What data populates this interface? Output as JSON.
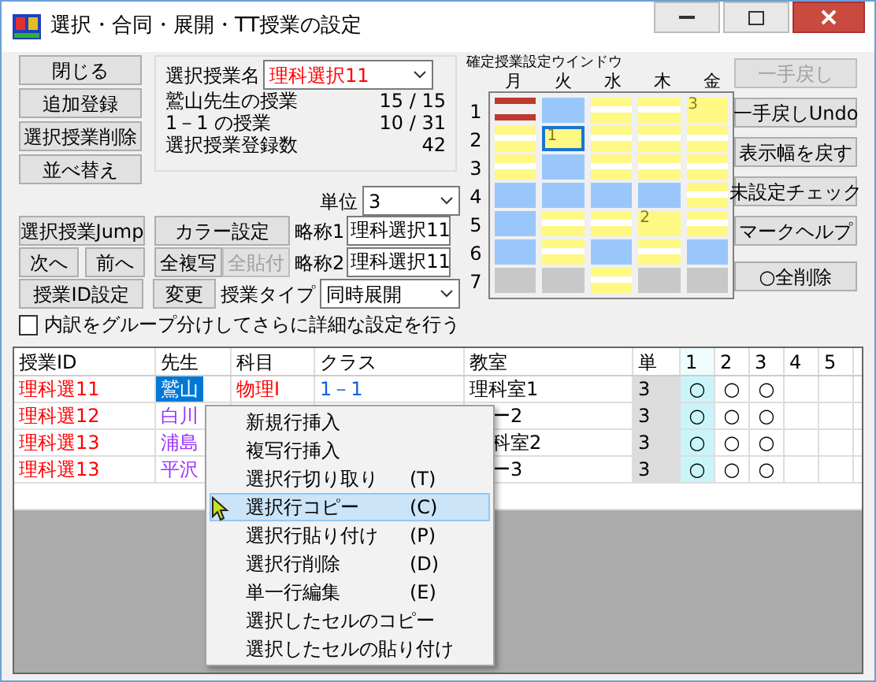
{
  "window": {
    "title": "選択・合同・展開・TT授業の設定"
  },
  "left_buttons": [
    {
      "label": "閉じる"
    },
    {
      "label": "追加登録"
    },
    {
      "label": "選択授業削除"
    },
    {
      "label": "並べ替え"
    }
  ],
  "info": {
    "name_label": "選択授業名",
    "name_value": "理科選択11",
    "lines": [
      {
        "label": "鷲山先生の授業",
        "value": "15 / 15"
      },
      {
        "label": "1－1 の授業",
        "value": "10 / 31"
      },
      {
        "label": "選択授業登録数",
        "value": "42"
      }
    ]
  },
  "unit": {
    "label": "単位",
    "value": "3"
  },
  "buttons": {
    "jump": "選択授業Jump",
    "next": "次へ",
    "prev": "前へ",
    "id_setting": "授業ID設定",
    "color_setting": "カラー設定",
    "copy_all": {
      "label": "全複写",
      "disabled": false
    },
    "paste_all": {
      "label": "全貼付",
      "disabled": true
    },
    "change": "変更"
  },
  "abbr": [
    {
      "label": "略称1",
      "value": "理科選択11"
    },
    {
      "label": "略称2",
      "value": "理科選択11"
    }
  ],
  "lesson_type": {
    "label": "授業タイプ",
    "value": "同時展開"
  },
  "detail_checkbox": {
    "label": "内訳をグループ分けしてさらに詳細な設定を行う",
    "checked": false
  },
  "grid": {
    "title": "確定授業設定ウインドウ",
    "days": [
      "月",
      "火",
      "水",
      "木",
      "金"
    ],
    "periods": [
      "1",
      "2",
      "3",
      "4",
      "5",
      "6",
      "7"
    ],
    "rows": [
      [
        {
          "kind": "red",
          "selected": false
        },
        {
          "kind": "blue",
          "selected": false
        },
        {
          "kind": "stripe",
          "selected": false
        },
        {
          "kind": "stripe",
          "selected": false
        },
        {
          "kind": "solid",
          "mark": "3",
          "selected": false
        }
      ],
      [
        {
          "kind": "stripe",
          "selected": false
        },
        {
          "kind": "solid",
          "mark": "1",
          "selected": true
        },
        {
          "kind": "stripe",
          "selected": false
        },
        {
          "kind": "stripe",
          "selected": false
        },
        {
          "kind": "stripe",
          "selected": false
        }
      ],
      [
        {
          "kind": "stripe",
          "selected": false
        },
        {
          "kind": "blue",
          "selected": false
        },
        {
          "kind": "stripe",
          "selected": false
        },
        {
          "kind": "stripe",
          "selected": false
        },
        {
          "kind": "stripe",
          "selected": false
        }
      ],
      [
        {
          "kind": "blue",
          "selected": false
        },
        {
          "kind": "blue",
          "selected": false
        },
        {
          "kind": "blue",
          "selected": false
        },
        {
          "kind": "blue",
          "selected": false
        },
        {
          "kind": "stripe",
          "selected": false
        }
      ],
      [
        {
          "kind": "blue",
          "selected": false
        },
        {
          "kind": "stripe",
          "selected": false
        },
        {
          "kind": "stripe",
          "selected": false
        },
        {
          "kind": "solid",
          "mark": "2",
          "selected": false
        },
        {
          "kind": "stripe",
          "selected": false
        }
      ],
      [
        {
          "kind": "blue",
          "selected": false
        },
        {
          "kind": "stripe",
          "selected": false
        },
        {
          "kind": "blue",
          "selected": false
        },
        {
          "kind": "stripe",
          "selected": false
        },
        {
          "kind": "blue",
          "selected": false
        }
      ],
      [
        {
          "kind": "grey",
          "selected": false
        },
        {
          "kind": "grey",
          "selected": false
        },
        {
          "kind": "stripe",
          "selected": false
        },
        {
          "kind": "grey",
          "selected": false
        },
        {
          "kind": "grey",
          "selected": false
        }
      ]
    ]
  },
  "right_buttons": [
    {
      "label": "一手戻し",
      "disabled": true
    },
    {
      "label": "一手戻しUndo",
      "disabled": false
    },
    {
      "label": "表示幅を戻す",
      "disabled": false
    },
    {
      "label": "未設定チェック",
      "disabled": false
    },
    {
      "label": "マークヘルプ",
      "disabled": false
    },
    {
      "label": "○全削除",
      "disabled": false
    }
  ],
  "table": {
    "columns": [
      {
        "label": "授業ID",
        "selected": false
      },
      {
        "label": "先生",
        "selected": false
      },
      {
        "label": "科目",
        "selected": false
      },
      {
        "label": "クラス",
        "selected": false
      },
      {
        "label": "教室",
        "selected": false
      },
      {
        "label": "単",
        "selected": false
      },
      {
        "label": "1",
        "selected": true
      },
      {
        "label": "2",
        "selected": false
      },
      {
        "label": "3",
        "selected": false
      },
      {
        "label": "4",
        "selected": false
      },
      {
        "label": "5",
        "selected": false
      }
    ],
    "rows": [
      {
        "id": "理科選11",
        "teacher": "鷲山",
        "teacher_selected": true,
        "subject": "物理Ⅰ",
        "class": "1－1",
        "room": "理科室1",
        "unit": "3",
        "marks": [
          "○",
          "○",
          "○"
        ]
      },
      {
        "id": "理科選12",
        "teacher": "白川",
        "teacher_selected": false,
        "room": "ー2",
        "unit": "3",
        "marks": [
          "○",
          "○",
          "○"
        ]
      },
      {
        "id": "理科選13",
        "teacher": "浦島",
        "teacher_selected": false,
        "room": "科室2",
        "unit": "3",
        "marks": [
          "○",
          "○",
          "○"
        ]
      },
      {
        "id": "理科選13",
        "teacher": "平沢",
        "teacher_selected": false,
        "room": "ー3",
        "unit": "3",
        "marks": [
          "○",
          "○",
          "○"
        ]
      }
    ]
  },
  "context_menu": {
    "items": [
      {
        "label": "新規行挿入",
        "selected": false
      },
      {
        "label": "複写行挿入",
        "selected": false
      },
      {
        "label": "選択行切り取り",
        "shortcut": "(T)",
        "selected": false
      },
      {
        "label": "選択行コピー",
        "shortcut": "(C)",
        "selected": true
      },
      {
        "label": "選択行貼り付け",
        "shortcut": "(P)",
        "selected": false
      },
      {
        "label": "選択行削除",
        "shortcut": "(D)",
        "selected": false
      },
      {
        "label": "単一行編集",
        "shortcut": "(E)",
        "selected": false
      },
      {
        "label": "選択したセルのコピー",
        "selected": false
      },
      {
        "label": "選択したセルの貼り付け",
        "selected": false
      }
    ]
  }
}
